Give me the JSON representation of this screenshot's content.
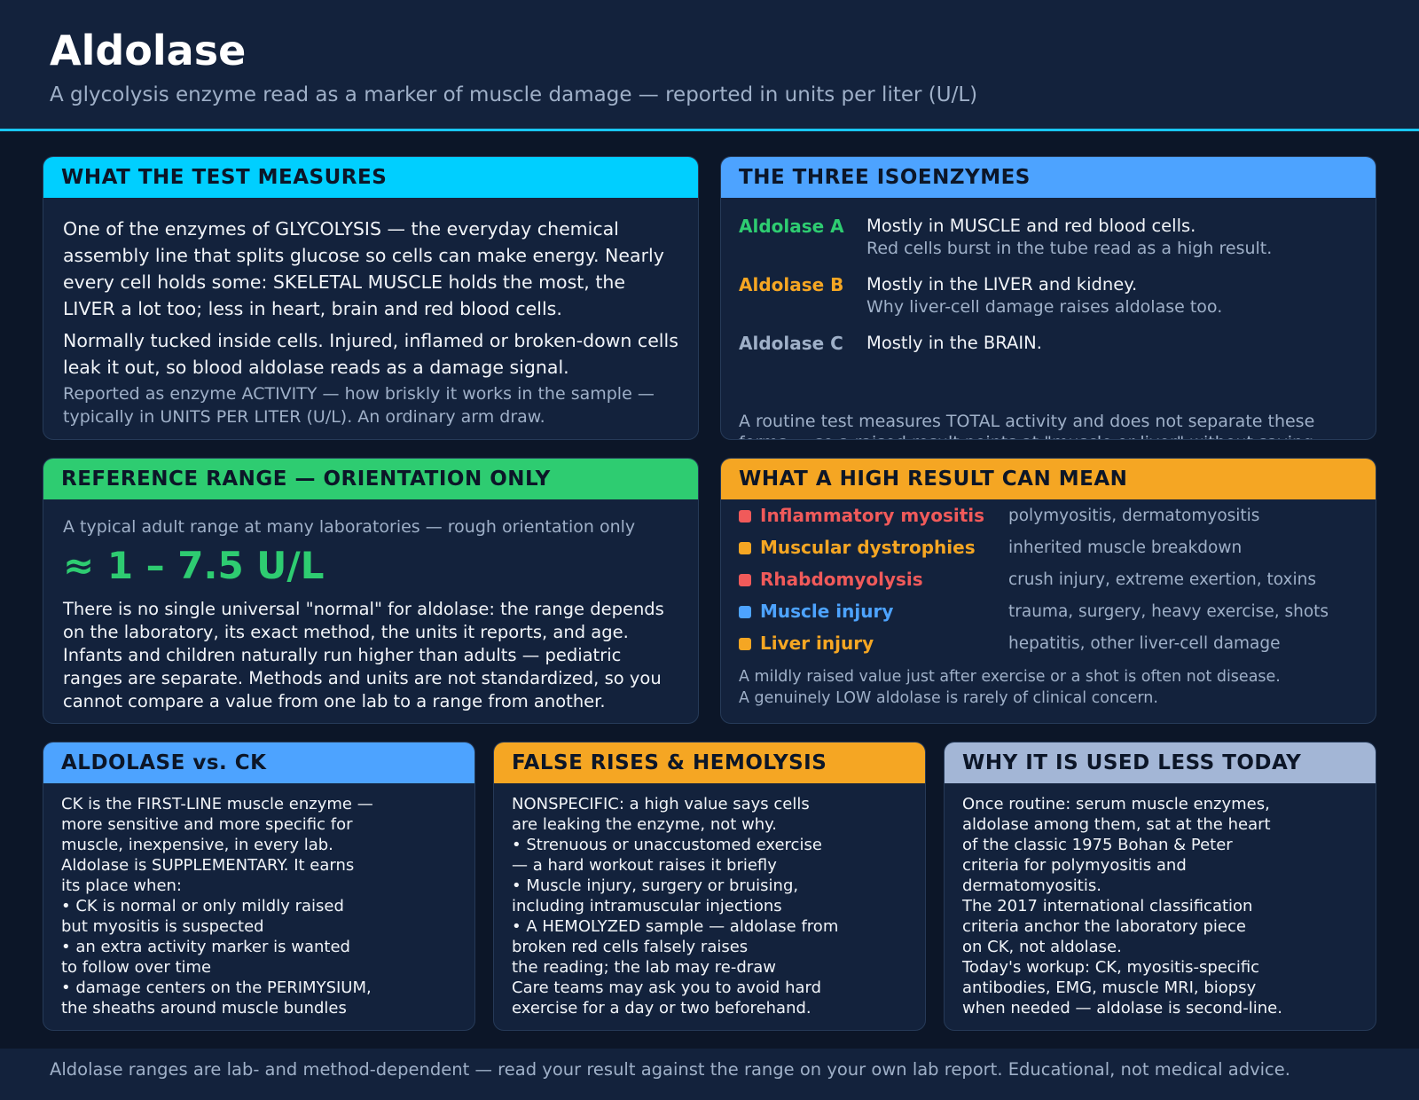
{
  "header": {
    "title": "Aldolase",
    "subtitle": "A glycolysis enzyme read as a marker of muscle damage — reported in units per liter (U/L)"
  },
  "measures": {
    "title": "WHAT THE TEST MEASURES",
    "color": "#00cfff",
    "p1": "One of the enzymes of GLYCOLYSIS — the everyday chemical assembly line that splits glucose so cells can make energy. Nearly every cell holds some: SKELETAL MUSCLE holds the most, the LIVER a lot too; less in heart, brain and red blood cells.",
    "p2": "Normally tucked inside cells. Injured, inflamed or broken-down cells leak it out, so blood aldolase reads as a damage signal.",
    "p3": "Reported as enzyme ACTIVITY — how briskly it works in the sample — typically in UNITS PER LITER (U/L). An ordinary arm draw."
  },
  "isoenzymes": {
    "title": "THE THREE ISOENZYMES",
    "color": "#4da3ff",
    "items": [
      {
        "name": "Aldolase A",
        "line1": "Mostly in MUSCLE and red blood cells.",
        "line2": "Red cells burst in the tube read as a high result.",
        "color": "#2ecc71"
      },
      {
        "name": "Aldolase B",
        "line1": "Mostly in the LIVER and kidney.",
        "line2": "Why liver-cell damage raises aldolase too.",
        "color": "#f5a623"
      },
      {
        "name": "Aldolase C",
        "line1": "Mostly in the BRAIN.",
        "line2": "",
        "color": "#9fb0c8"
      }
    ],
    "note": "A routine test measures TOTAL activity and does not separate these forms — so a raised result points at \"muscle or liver\" without saying which."
  },
  "range": {
    "title": "REFERENCE RANGE — ORIENTATION ONLY",
    "color": "#2ecc71",
    "intro": "A typical adult range at many laboratories — rough orientation only",
    "value": "≈ 1 – 7.5 U/L",
    "desc": "There is no single universal \"normal\" for aldolase: the range depends on the laboratory, its exact method, the units it reports, and age. Infants and children naturally run higher than adults — pediatric ranges are separate. Methods and units are not standardized, so you cannot compare a value from one lab to a range from another."
  },
  "high": {
    "title": "WHAT A HIGH RESULT CAN MEAN",
    "color": "#f5a623",
    "causes": [
      {
        "name": "Inflammatory myositis",
        "desc": "polymyositis, dermatomyositis",
        "color": "#f05a5a"
      },
      {
        "name": "Muscular dystrophies",
        "desc": "inherited muscle breakdown",
        "color": "#f5a623"
      },
      {
        "name": "Rhabdomyolysis",
        "desc": "crush injury, extreme exertion, toxins",
        "color": "#f05a5a"
      },
      {
        "name": "Muscle injury",
        "desc": "trauma, surgery, heavy exercise, shots",
        "color": "#4da3ff"
      },
      {
        "name": "Liver injury",
        "desc": "hepatitis, other liver-cell damage",
        "color": "#f5a623"
      }
    ],
    "note1": "A mildly raised value just after exercise or a shot is often not disease.",
    "note2": "A genuinely LOW aldolase is rarely of clinical concern."
  },
  "vs_ck": {
    "title": "ALDOLASE vs. CK",
    "color": "#4da3ff",
    "lines": [
      "CK is the FIRST-LINE muscle enzyme —",
      "more sensitive and more specific for",
      "muscle, inexpensive, in every lab.",
      "Aldolase is SUPPLEMENTARY. It earns",
      "its place when:",
      "• CK is normal or only mildly raised",
      "but myositis is suspected",
      "• an extra activity marker is wanted",
      "to follow over time",
      "• damage centers on the PERIMYSIUM,",
      "the sheaths around muscle bundles"
    ]
  },
  "false_rises": {
    "title": "FALSE RISES & HEMOLYSIS",
    "color": "#f5a623",
    "lines": [
      "NONSPECIFIC: a high value says cells",
      "are leaking the enzyme, not why.",
      "• Strenuous or unaccustomed exercise",
      "— a hard workout raises it briefly",
      "• Muscle injury, surgery or bruising,",
      "including intramuscular injections",
      "• A HEMOLYZED sample — aldolase from",
      "broken red cells falsely raises",
      "the reading; the lab may re-draw",
      "Care teams may ask you to avoid hard",
      "exercise for a day or two beforehand."
    ]
  },
  "less_today": {
    "title": "WHY IT IS USED LESS TODAY",
    "color": "#a3b6d6",
    "lines": [
      "Once routine: serum muscle enzymes,",
      "aldolase among them, sat at the heart",
      "of the classic 1975 Bohan & Peter",
      "criteria for polymyositis and",
      "dermatomyositis.",
      "The 2017 international classification",
      "criteria anchor the laboratory piece",
      "on CK, not aldolase.",
      "Today's workup: CK, myositis-specific",
      "antibodies, EMG, muscle MRI, biopsy",
      "when needed — aldolase is second-line."
    ]
  },
  "footer": "Aldolase ranges are lab- and method-dependent — read your result against the range on your own lab report. Educational, not medical advice."
}
